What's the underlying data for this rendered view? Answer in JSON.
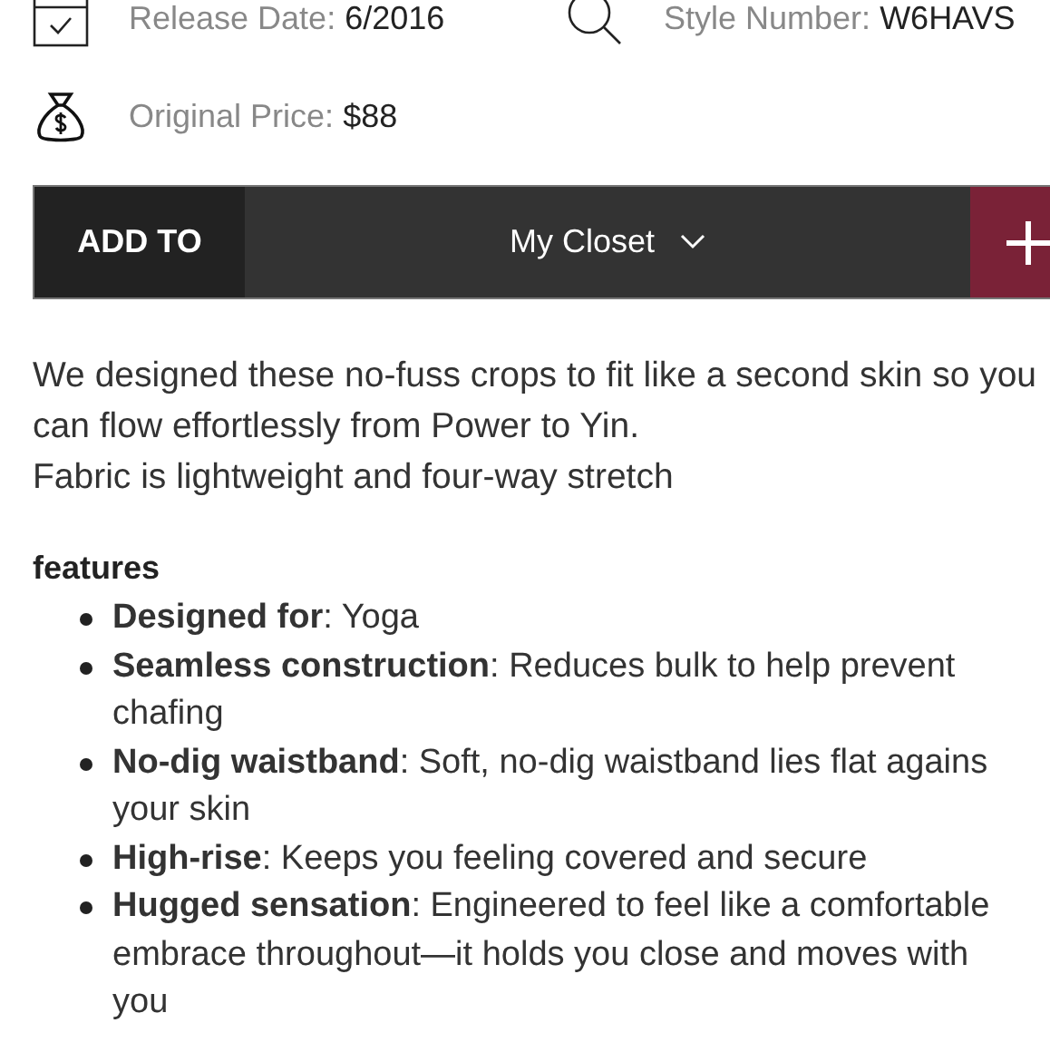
{
  "specs": [
    {
      "kind": "calendar",
      "label": "Release Date:",
      "value": "6/2016"
    },
    {
      "kind": "search",
      "label": "Style Number:",
      "value": "W6HAVS"
    },
    {
      "kind": "moneybag",
      "label": "Original Price:",
      "value": "$88"
    }
  ],
  "add_bar": {
    "label": "ADD TO",
    "list": "My Closet"
  },
  "description": [
    "We designed these no-fuss crops to fit like a second skin so you",
    "can flow effortlessly from Power to Yin.",
    "Fabric is lightweight and four-way stretch"
  ],
  "features": {
    "title": "features",
    "items": [
      {
        "lines": [
          "**Designed for**: Yoga"
        ]
      },
      {
        "lines": [
          "**Seamless construction**: Reduces bulk to help prevent",
          "chafing"
        ]
      },
      {
        "lines": [
          "**No-dig waistband**: Soft, no-dig waistband lies flat agains",
          "your skin"
        ]
      },
      {
        "lines": [
          "**High-rise**: Keeps you feeling covered and secure"
        ]
      },
      {
        "lines": [
          "**Hugged sensation**: Engineered to feel like a comfortable",
          "embrace throughout—it holds you close and moves with",
          "you"
        ]
      }
    ]
  }
}
